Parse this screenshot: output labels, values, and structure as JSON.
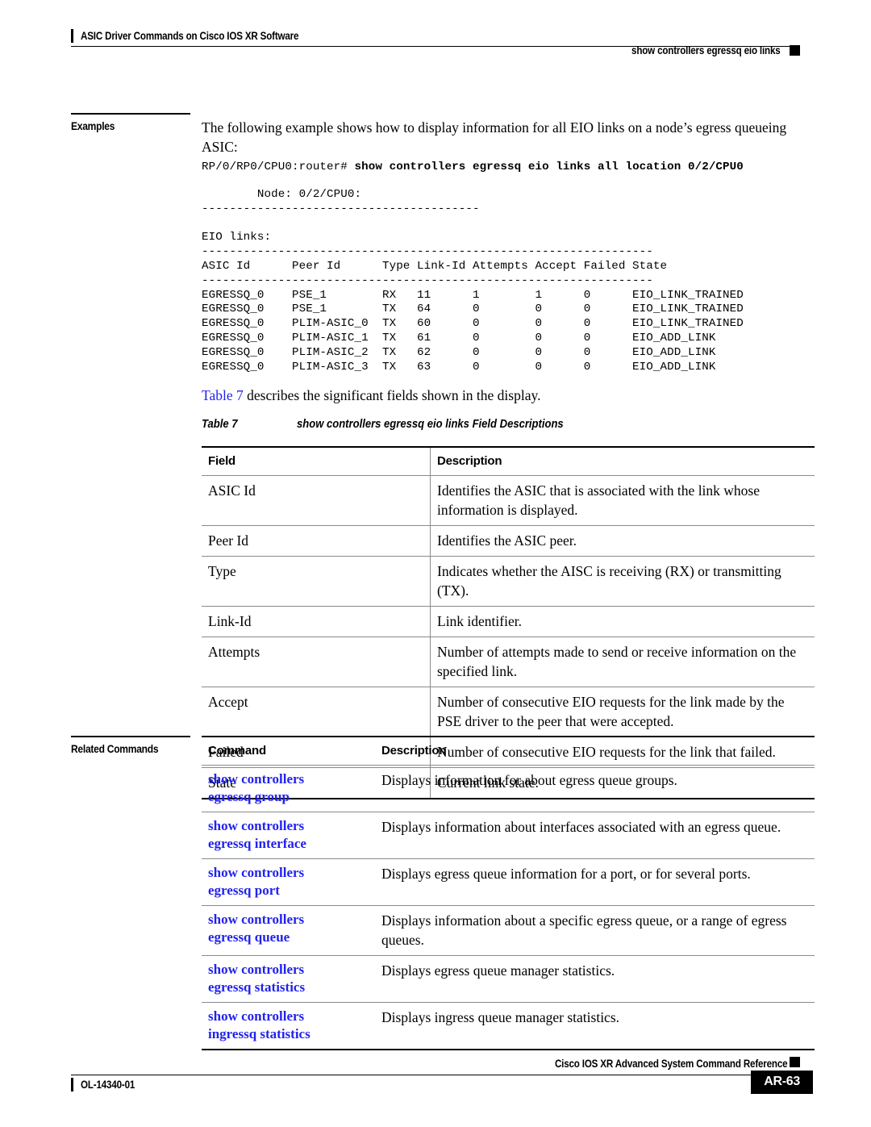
{
  "running_header": {
    "left_title": "ASIC Driver Commands on Cisco IOS XR Software",
    "right_title": "show controllers egressq eio links"
  },
  "sections": {
    "examples_label": "Examples",
    "related_commands_label": "Related Commands"
  },
  "examples": {
    "intro_paragraph": "The following example shows how to display information for all EIO links on a node’s egress queueing ASIC:",
    "prompt": "RP/0/RP0/CPU0:router# ",
    "command": "show controllers egressq eio links all location 0/2/CPU0",
    "output_lines": [
      "        Node: 0/2/CPU0:",
      "----------------------------------------",
      "",
      "EIO links:",
      "-----------------------------------------------------------------",
      "ASIC Id      Peer Id      Type Link-Id Attempts Accept Failed State",
      "-----------------------------------------------------------------",
      "EGRESSQ_0    PSE_1        RX   11      1        1      0      EIO_LINK_TRAINED",
      "EGRESSQ_0    PSE_1        TX   64      0        0      0      EIO_LINK_TRAINED",
      "EGRESSQ_0    PLIM-ASIC_0  TX   60      0        0      0      EIO_LINK_TRAINED",
      "EGRESSQ_0    PLIM-ASIC_1  TX   61      0        0      0      EIO_ADD_LINK",
      "EGRESSQ_0    PLIM-ASIC_2  TX   62      0        0      0      EIO_ADD_LINK",
      "EGRESSQ_0    PLIM-ASIC_3  TX   63      0        0      0      EIO_ADD_LINK"
    ],
    "table_ref_link": "Table 7",
    "table_ref_rest": " describes the significant fields shown in the display."
  },
  "field_table": {
    "caption_number": "Table 7",
    "caption_title": "show controllers egressq eio links Field Descriptions",
    "headers": [
      "Field",
      "Description"
    ],
    "rows": [
      [
        "ASIC Id",
        "Identifies the ASIC that is associated with the link whose information is displayed."
      ],
      [
        "Peer Id",
        "Identifies the ASIC peer."
      ],
      [
        "Type",
        "Indicates whether the AISC is receiving (RX) or transmitting (TX)."
      ],
      [
        "Link-Id",
        "Link identifier."
      ],
      [
        "Attempts",
        "Number of attempts made to send or receive information on the specified link."
      ],
      [
        "Accept",
        "Number of consecutive EIO requests for the link made by the PSE driver to the peer that were accepted."
      ],
      [
        "Failed",
        "Number of consecutive EIO requests for the link that failed."
      ],
      [
        "State",
        "Current link state."
      ]
    ]
  },
  "related_table": {
    "headers": [
      "Command",
      "Description"
    ],
    "rows": [
      {
        "command_line1": "show controllers",
        "command_line2": "egressq group",
        "description": "Displays information for about egress queue groups."
      },
      {
        "command_line1": "show controllers",
        "command_line2": "egressq interface",
        "description": "Displays information about interfaces associated with an egress queue."
      },
      {
        "command_line1": "show controllers",
        "command_line2": "egressq port",
        "description": "Displays egress queue information for a port, or for several ports."
      },
      {
        "command_line1": "show controllers",
        "command_line2": "egressq queue",
        "description": "Displays information about a specific egress queue, or a range of egress queues."
      },
      {
        "command_line1": "show controllers",
        "command_line2": "egressq statistics",
        "description": "Displays egress queue manager statistics."
      },
      {
        "command_line1": "show controllers",
        "command_line2": "ingressq statistics",
        "description": "Displays ingress queue manager statistics."
      }
    ]
  },
  "footer": {
    "doc_title": "Cisco IOS XR Advanced System Command Reference",
    "doc_number": "OL-14340-01",
    "page_number": "AR-63"
  },
  "colors": {
    "link": "#2222ee",
    "rule": "#000000",
    "table_hairline": "#8a8a8a",
    "page_box_bg": "#000000",
    "page_box_fg": "#ffffff"
  }
}
